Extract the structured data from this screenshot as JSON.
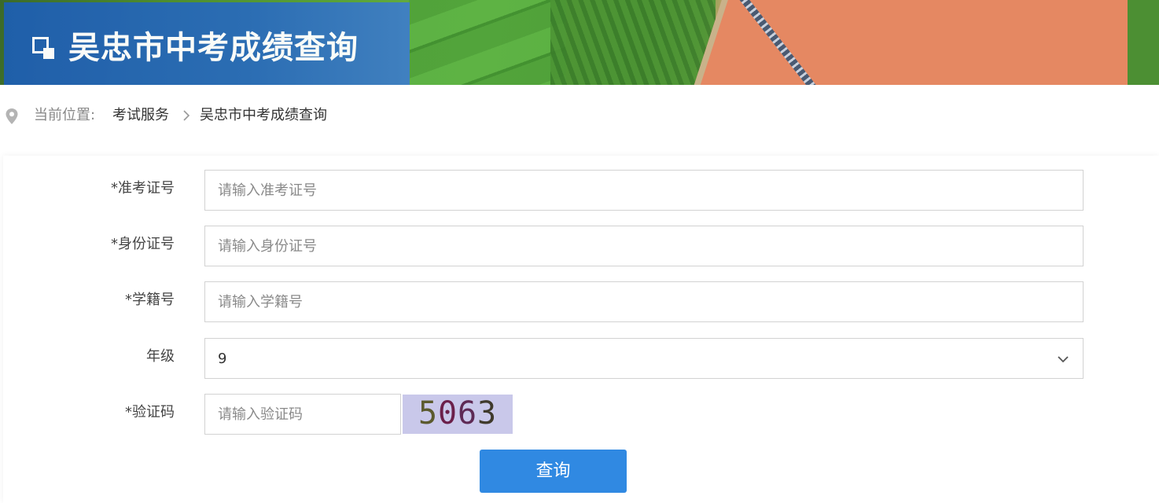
{
  "header": {
    "title": "吴忠市中考成绩查询"
  },
  "breadcrumb": {
    "prefix": "当前位置:",
    "items": [
      {
        "label": "考试服务"
      },
      {
        "label": "吴忠市中考成绩查询"
      }
    ]
  },
  "form": {
    "fields": [
      {
        "label": "*准考证号",
        "placeholder": "请输入准考证号",
        "value": ""
      },
      {
        "label": "*身份证号",
        "placeholder": "请输入身份证号",
        "value": ""
      },
      {
        "label": "*学籍号",
        "placeholder": "请输入学籍号",
        "value": ""
      }
    ],
    "grade": {
      "label": "年级",
      "value": "9"
    },
    "captcha": {
      "label": "*验证码",
      "placeholder": "请输入验证码",
      "value": "",
      "code_digits": [
        "5",
        "0",
        "6",
        "3"
      ],
      "digit_colors": [
        "#5b5a2e",
        "#6b1f4a",
        "#5e2a55",
        "#3f3a2c"
      ]
    },
    "submit_label": "查询"
  },
  "colors": {
    "title_plate": "#1f5fae",
    "button": "#3089e2",
    "captcha_bg": "#c9c8ea"
  }
}
